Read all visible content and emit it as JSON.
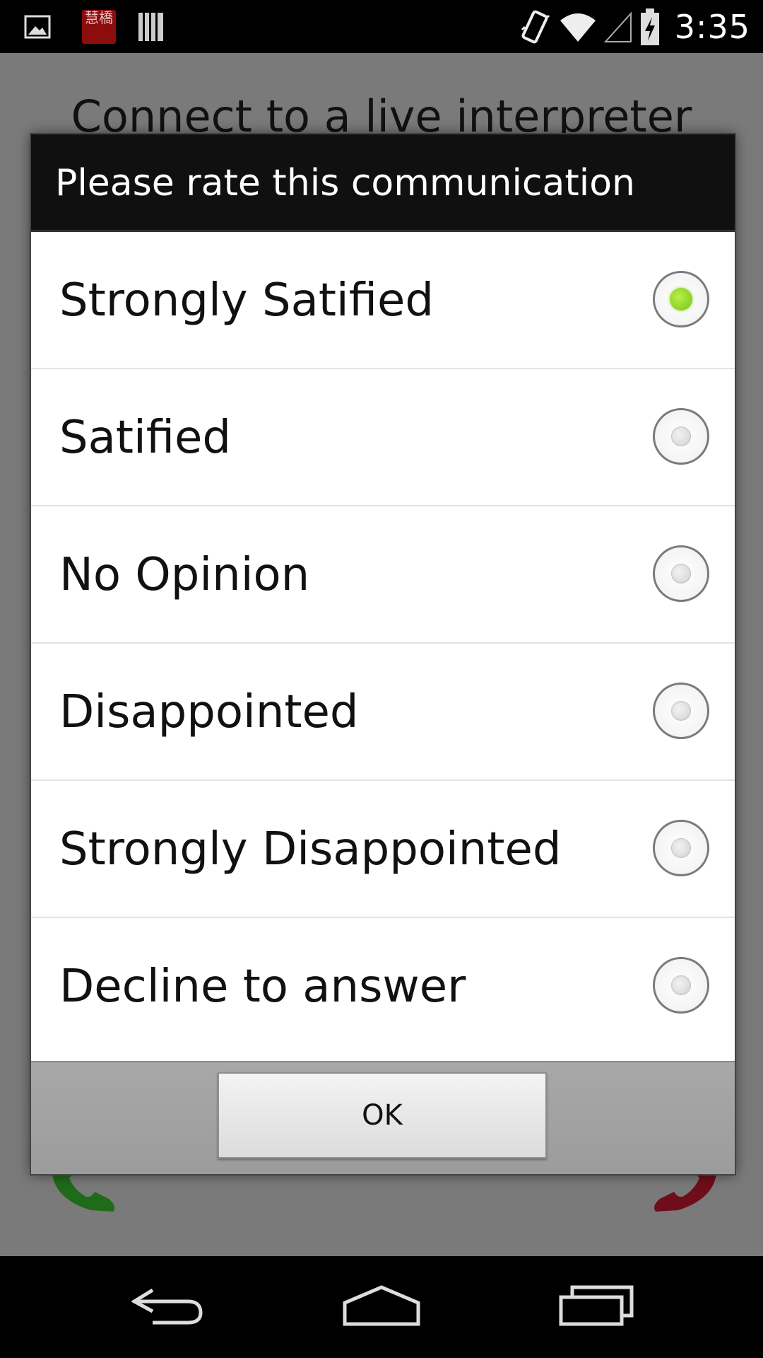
{
  "status_bar": {
    "time": "3:35",
    "app_icon_text": "慧橋",
    "icons": [
      "picture-icon",
      "app-icon",
      "barcode-icon",
      "vibrate-icon",
      "wifi-icon",
      "signal-icon",
      "battery-charging-icon"
    ]
  },
  "background": {
    "title": "Connect to a live interpreter"
  },
  "dialog": {
    "title": "Please rate this communication",
    "options": [
      {
        "label": "Strongly Satified",
        "checked": true
      },
      {
        "label": "Satified",
        "checked": false
      },
      {
        "label": "No Opinion",
        "checked": false
      },
      {
        "label": "Disappointed",
        "checked": false
      },
      {
        "label": "Strongly Disappointed",
        "checked": false
      },
      {
        "label": "Decline to answer",
        "checked": false
      }
    ],
    "ok_label": "OK"
  },
  "nav_bar": {
    "icons": [
      "back-icon",
      "home-icon",
      "recents-icon"
    ]
  },
  "colors": {
    "radio_selected": "#8fd92a",
    "call_accept": "#1e7a1a",
    "call_decline": "#8a0f1f"
  }
}
